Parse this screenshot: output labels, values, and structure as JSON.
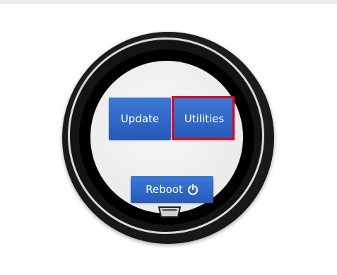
{
  "buttons": {
    "update_label": "Update",
    "utilities_label": "Utilities",
    "reboot_label": "Reboot"
  },
  "icons": {
    "reboot": "power-icon",
    "bottom": "port-icon"
  },
  "colors": {
    "button_blue": "#2f67c9",
    "highlight_red": "#e0001b",
    "screen_bg": "#ebebeb"
  },
  "highlight": {
    "target": "utilities"
  }
}
